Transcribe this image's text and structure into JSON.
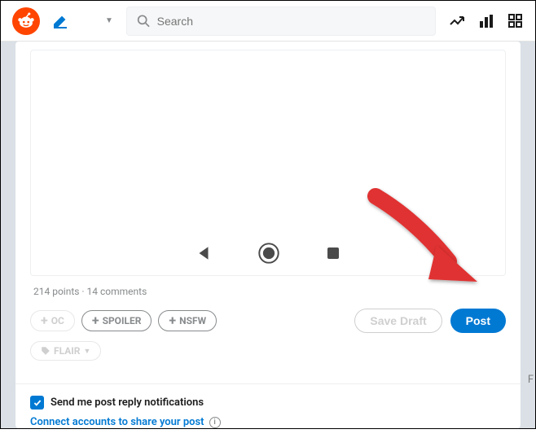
{
  "header": {
    "search_placeholder": "Search"
  },
  "preview": {
    "points_line": "214 points · 14 comments"
  },
  "tags": {
    "oc": "OC",
    "spoiler": "SPOILER",
    "nsfw": "NSFW",
    "flair": "FLAIR"
  },
  "actions": {
    "save_draft": "Save Draft",
    "post": "Post"
  },
  "footer": {
    "notify_label": "Send me post reply notifications",
    "connect_label": "Connect accounts to share your post"
  },
  "side_char": "F"
}
